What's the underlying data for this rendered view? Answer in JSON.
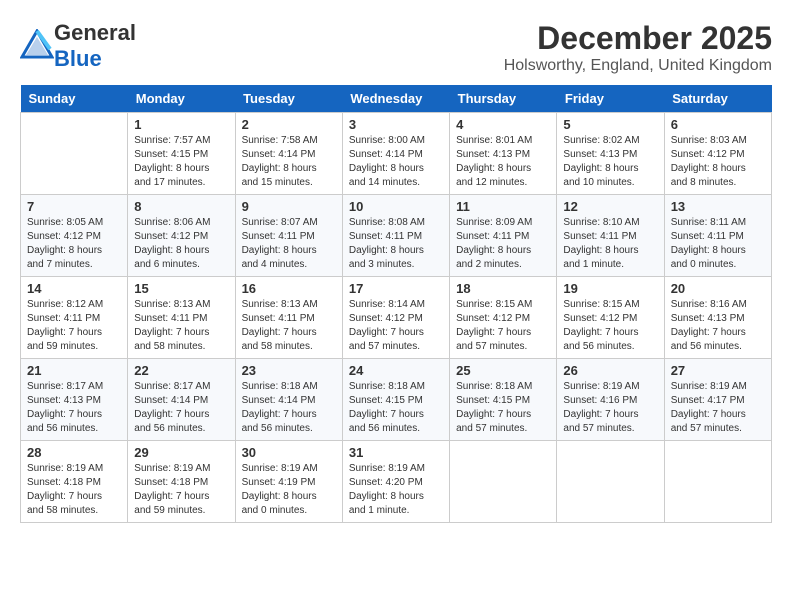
{
  "header": {
    "logo_general": "General",
    "logo_blue": "Blue",
    "month": "December 2025",
    "location": "Holsworthy, England, United Kingdom"
  },
  "weekdays": [
    "Sunday",
    "Monday",
    "Tuesday",
    "Wednesday",
    "Thursday",
    "Friday",
    "Saturday"
  ],
  "weeks": [
    [
      {
        "day": "",
        "sunrise": "",
        "sunset": "",
        "daylight": "",
        "empty": true
      },
      {
        "day": "1",
        "sunrise": "7:57 AM",
        "sunset": "4:15 PM",
        "daylight": "8 hours and 17 minutes."
      },
      {
        "day": "2",
        "sunrise": "7:58 AM",
        "sunset": "4:14 PM",
        "daylight": "8 hours and 15 minutes."
      },
      {
        "day": "3",
        "sunrise": "8:00 AM",
        "sunset": "4:14 PM",
        "daylight": "8 hours and 14 minutes."
      },
      {
        "day": "4",
        "sunrise": "8:01 AM",
        "sunset": "4:13 PM",
        "daylight": "8 hours and 12 minutes."
      },
      {
        "day": "5",
        "sunrise": "8:02 AM",
        "sunset": "4:13 PM",
        "daylight": "8 hours and 10 minutes."
      },
      {
        "day": "6",
        "sunrise": "8:03 AM",
        "sunset": "4:12 PM",
        "daylight": "8 hours and 8 minutes."
      }
    ],
    [
      {
        "day": "7",
        "sunrise": "8:05 AM",
        "sunset": "4:12 PM",
        "daylight": "8 hours and 7 minutes."
      },
      {
        "day": "8",
        "sunrise": "8:06 AM",
        "sunset": "4:12 PM",
        "daylight": "8 hours and 6 minutes."
      },
      {
        "day": "9",
        "sunrise": "8:07 AM",
        "sunset": "4:11 PM",
        "daylight": "8 hours and 4 minutes."
      },
      {
        "day": "10",
        "sunrise": "8:08 AM",
        "sunset": "4:11 PM",
        "daylight": "8 hours and 3 minutes."
      },
      {
        "day": "11",
        "sunrise": "8:09 AM",
        "sunset": "4:11 PM",
        "daylight": "8 hours and 2 minutes."
      },
      {
        "day": "12",
        "sunrise": "8:10 AM",
        "sunset": "4:11 PM",
        "daylight": "8 hours and 1 minute."
      },
      {
        "day": "13",
        "sunrise": "8:11 AM",
        "sunset": "4:11 PM",
        "daylight": "8 hours and 0 minutes."
      }
    ],
    [
      {
        "day": "14",
        "sunrise": "8:12 AM",
        "sunset": "4:11 PM",
        "daylight": "7 hours and 59 minutes."
      },
      {
        "day": "15",
        "sunrise": "8:13 AM",
        "sunset": "4:11 PM",
        "daylight": "7 hours and 58 minutes."
      },
      {
        "day": "16",
        "sunrise": "8:13 AM",
        "sunset": "4:11 PM",
        "daylight": "7 hours and 58 minutes."
      },
      {
        "day": "17",
        "sunrise": "8:14 AM",
        "sunset": "4:12 PM",
        "daylight": "7 hours and 57 minutes."
      },
      {
        "day": "18",
        "sunrise": "8:15 AM",
        "sunset": "4:12 PM",
        "daylight": "7 hours and 57 minutes."
      },
      {
        "day": "19",
        "sunrise": "8:15 AM",
        "sunset": "4:12 PM",
        "daylight": "7 hours and 56 minutes."
      },
      {
        "day": "20",
        "sunrise": "8:16 AM",
        "sunset": "4:13 PM",
        "daylight": "7 hours and 56 minutes."
      }
    ],
    [
      {
        "day": "21",
        "sunrise": "8:17 AM",
        "sunset": "4:13 PM",
        "daylight": "7 hours and 56 minutes."
      },
      {
        "day": "22",
        "sunrise": "8:17 AM",
        "sunset": "4:14 PM",
        "daylight": "7 hours and 56 minutes."
      },
      {
        "day": "23",
        "sunrise": "8:18 AM",
        "sunset": "4:14 PM",
        "daylight": "7 hours and 56 minutes."
      },
      {
        "day": "24",
        "sunrise": "8:18 AM",
        "sunset": "4:15 PM",
        "daylight": "7 hours and 56 minutes."
      },
      {
        "day": "25",
        "sunrise": "8:18 AM",
        "sunset": "4:15 PM",
        "daylight": "7 hours and 57 minutes."
      },
      {
        "day": "26",
        "sunrise": "8:19 AM",
        "sunset": "4:16 PM",
        "daylight": "7 hours and 57 minutes."
      },
      {
        "day": "27",
        "sunrise": "8:19 AM",
        "sunset": "4:17 PM",
        "daylight": "7 hours and 57 minutes."
      }
    ],
    [
      {
        "day": "28",
        "sunrise": "8:19 AM",
        "sunset": "4:18 PM",
        "daylight": "7 hours and 58 minutes."
      },
      {
        "day": "29",
        "sunrise": "8:19 AM",
        "sunset": "4:18 PM",
        "daylight": "7 hours and 59 minutes."
      },
      {
        "day": "30",
        "sunrise": "8:19 AM",
        "sunset": "4:19 PM",
        "daylight": "8 hours and 0 minutes."
      },
      {
        "day": "31",
        "sunrise": "8:19 AM",
        "sunset": "4:20 PM",
        "daylight": "8 hours and 1 minute."
      },
      {
        "day": "",
        "sunrise": "",
        "sunset": "",
        "daylight": "",
        "empty": true
      },
      {
        "day": "",
        "sunrise": "",
        "sunset": "",
        "daylight": "",
        "empty": true
      },
      {
        "day": "",
        "sunrise": "",
        "sunset": "",
        "daylight": "",
        "empty": true
      }
    ]
  ],
  "labels": {
    "sunrise_prefix": "Sunrise: ",
    "sunset_prefix": "Sunset: ",
    "daylight_prefix": "Daylight: "
  }
}
